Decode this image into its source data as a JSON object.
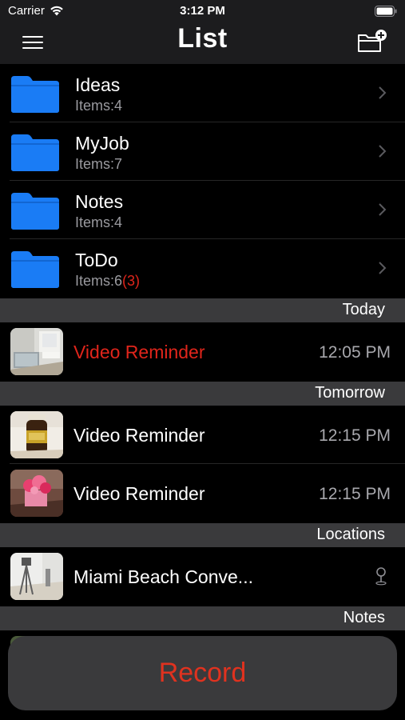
{
  "status_bar": {
    "carrier": "Carrier",
    "time": "3:12 PM"
  },
  "nav": {
    "title": "List",
    "menu_icon": "hamburger-menu-icon",
    "add_icon": "add-folder-icon"
  },
  "colors": {
    "folder_blue": "#1a7cf5",
    "overdue_red": "#e0251b",
    "record_red": "#e0321f",
    "section_gray": "#3a3a3c"
  },
  "folders": [
    {
      "name": "Ideas",
      "count": "Items:4",
      "overdue": ""
    },
    {
      "name": "MyJob",
      "count": "Items:7",
      "overdue": ""
    },
    {
      "name": "Notes",
      "count": "Items:4",
      "overdue": ""
    },
    {
      "name": "ToDo",
      "count": "Items:6",
      "overdue": "(3)"
    }
  ],
  "sections": {
    "today": {
      "header": "Today",
      "items": [
        {
          "title": "Video Reminder",
          "time": "12:05 PM",
          "overdue": true
        }
      ]
    },
    "tomorrow": {
      "header": "Tomorrow",
      "items": [
        {
          "title": "Video Reminder",
          "time": "12:15 PM",
          "overdue": false
        },
        {
          "title": "Video Reminder",
          "time": "12:15 PM",
          "overdue": false
        }
      ]
    },
    "locations": {
      "header": "Locations",
      "items": [
        {
          "title": "Miami Beach Conve...",
          "icon": "location-pin-icon"
        }
      ]
    },
    "notes": {
      "header": "Notes"
    }
  },
  "record": {
    "label": "Record"
  }
}
